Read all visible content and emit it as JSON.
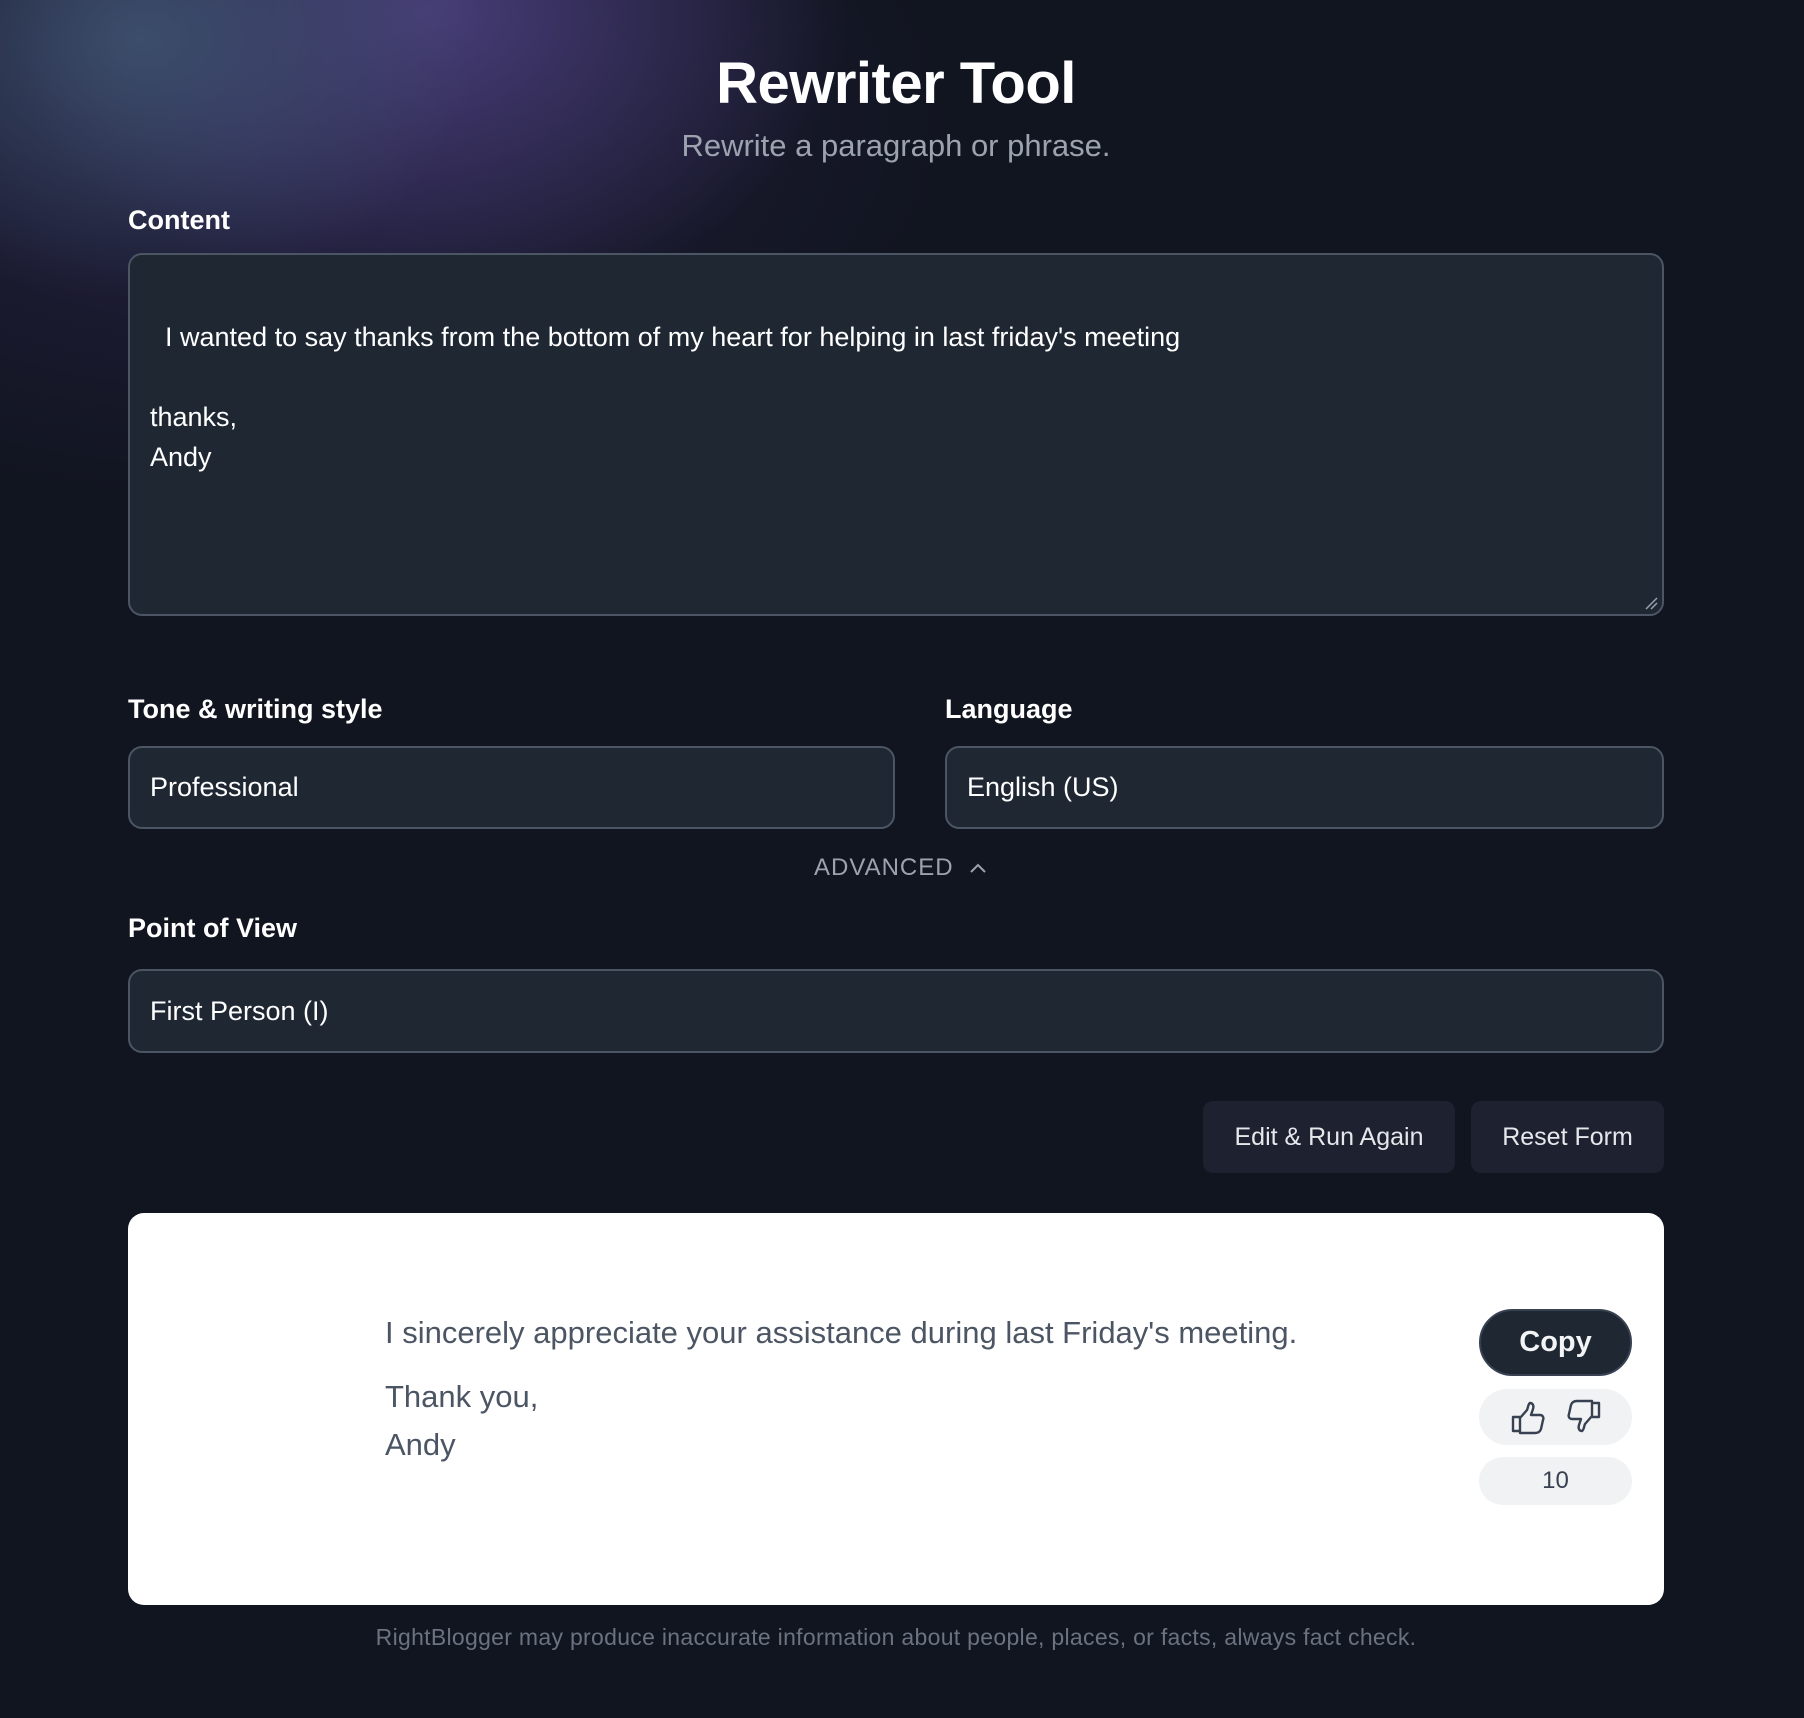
{
  "header": {
    "title": "Rewriter Tool",
    "subtitle": "Rewrite a paragraph or phrase."
  },
  "form": {
    "content": {
      "label": "Content",
      "value": "I wanted to say thanks from the bottom of my heart for helping in last friday's meeting\n\nthanks,\nAndy"
    },
    "tone": {
      "label": "Tone & writing style",
      "value": "Professional"
    },
    "language": {
      "label": "Language",
      "value": "English (US)"
    },
    "advanced_toggle": {
      "label": "ADVANCED",
      "icon": "chevron-up-icon",
      "expanded": true
    },
    "point_of_view": {
      "label": "Point of View",
      "value": "First Person (I)"
    }
  },
  "actions": {
    "edit_run_again": "Edit & Run Again",
    "reset_form": "Reset Form"
  },
  "result": {
    "paragraphs": [
      "I sincerely appreciate your assistance during last Friday's meeting.",
      "Thank you,",
      "Andy"
    ],
    "copy_label": "Copy",
    "thumbs_up_icon": "thumbs-up-icon",
    "thumbs_down_icon": "thumbs-down-icon",
    "count": "10"
  },
  "footer": {
    "disclaimer": "RightBlogger may produce inaccurate information about people, places, or facts, always fact check."
  },
  "colors": {
    "background": "#111520",
    "field_background": "#1f2733",
    "field_border": "#4b5563",
    "button_background": "#1e2230",
    "card_background": "#ffffff",
    "result_text": "#4b5563",
    "muted_text": "#9ca3af"
  }
}
